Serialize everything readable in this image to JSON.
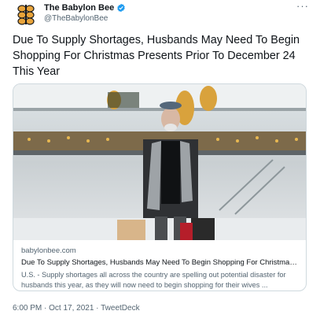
{
  "account": {
    "display_name": "The Babylon Bee",
    "handle": "@TheBabylonBee",
    "verified_icon": "verified-badge-icon",
    "avatar_icon": "bee-logo-icon"
  },
  "menu_icon": "more-options-icon",
  "more_label": "···",
  "tweet": {
    "text": "Due To Supply Shortages, Husbands May Need To Begin Shopping For Christmas Presents Prior To December 24 This Year"
  },
  "card": {
    "domain": "babylonbee.com",
    "title": "Due To Supply Shortages, Husbands May Need To Begin Shopping For Christmas Presents Prior To December 24 This Year",
    "description": "U.S. - Supply shortages all across the country are spelling out potential disaster for husbands this year, as they will now need to begin shopping for their wives ..."
  },
  "footer": {
    "time": "6:00 PM",
    "separator": " · ",
    "date": "Oct 17, 2021",
    "separator2": " · ",
    "source": "TweetDeck"
  },
  "colors": {
    "text": "#0f1419",
    "secondary": "#536471",
    "verified": "#1d9bf0",
    "border": "#cfd9de",
    "bee_gold": "#e8a33a"
  }
}
